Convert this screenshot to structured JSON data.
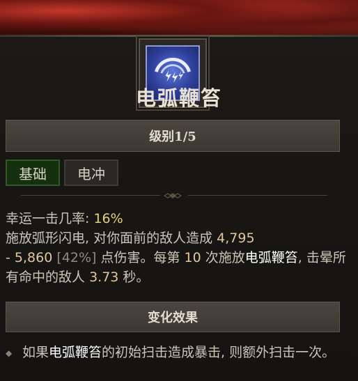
{
  "skill": {
    "name": "电弧鞭笞",
    "icon": "arc-lash-icon",
    "rank_label": "级别1/5",
    "tags": [
      "基础",
      "电冲"
    ]
  },
  "description": {
    "luck_label": "幸运一击几率:",
    "luck_value": "16%",
    "part1": "施放弧形闪电, 对你面前的敌人造成",
    "damage_min": "4,795",
    "dash": "-",
    "damage_max": "5,860",
    "damage_pct": "[42%]",
    "part2": "点伤害。每第",
    "cast_count": "10",
    "part3": "次施放",
    "skill_ref": "电弧鞭笞",
    "part4": ", 击晕所有命中的敌人",
    "stun_duration": "3.73",
    "part5": "秒。"
  },
  "effects": {
    "header": "变化效果",
    "bullet_prefix": "如果",
    "bullet_skill": "电弧鞭笞",
    "bullet_rest": "的初始扫击造成暴击, 则额外扫击一次。"
  },
  "colors": {
    "tag_basic_bg": "#14300f",
    "icon_blue": "#2e3f9a",
    "value_tan": "#dfc8a0",
    "luck_yellow": "#e5d27a"
  }
}
